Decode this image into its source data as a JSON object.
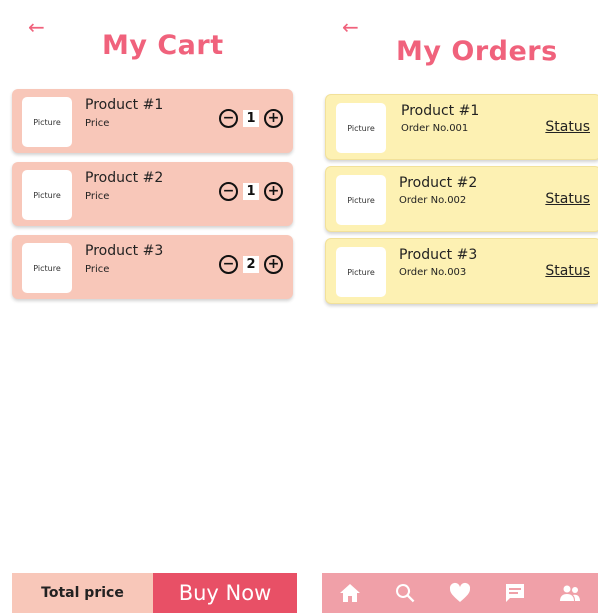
{
  "cart": {
    "back_icon": "arrow-left",
    "title": "My Cart",
    "items": [
      {
        "name": "Product #1",
        "sub": "Price",
        "pic": "Picture",
        "minus": "⊖",
        "qty": "1",
        "plus": "⊕"
      },
      {
        "name": "Product #2",
        "sub": "Price",
        "pic": "Picture",
        "minus": "⊖",
        "qty": "1",
        "plus": "⊕"
      },
      {
        "name": "Product #3",
        "sub": "Price",
        "pic": "Picture",
        "minus": "⊖",
        "qty": "2",
        "plus": "⊕"
      }
    ],
    "total_label": "Total price",
    "buy_label": "Buy Now"
  },
  "orders": {
    "back_icon": "arrow-left",
    "title": "My Orders",
    "items": [
      {
        "name": "Product #1",
        "sub": "Order No.001",
        "pic": "Picture",
        "status": "Status"
      },
      {
        "name": "Product #2",
        "sub": "Order No.002",
        "pic": "Picture",
        "status": "Status"
      },
      {
        "name": "Product #3",
        "sub": "Order No.003",
        "pic": "Picture",
        "status": "Status"
      }
    ],
    "nav": [
      "home-icon",
      "search-icon",
      "heart-icon",
      "chat-icon",
      "people-icon"
    ]
  },
  "colors": {
    "accent": "#f0627c",
    "cart_item_bg": "#f8c7b9",
    "order_item_bg": "#fdf1b3",
    "buy_bg": "#e85066",
    "nav_bg": "#f0a0a8"
  }
}
